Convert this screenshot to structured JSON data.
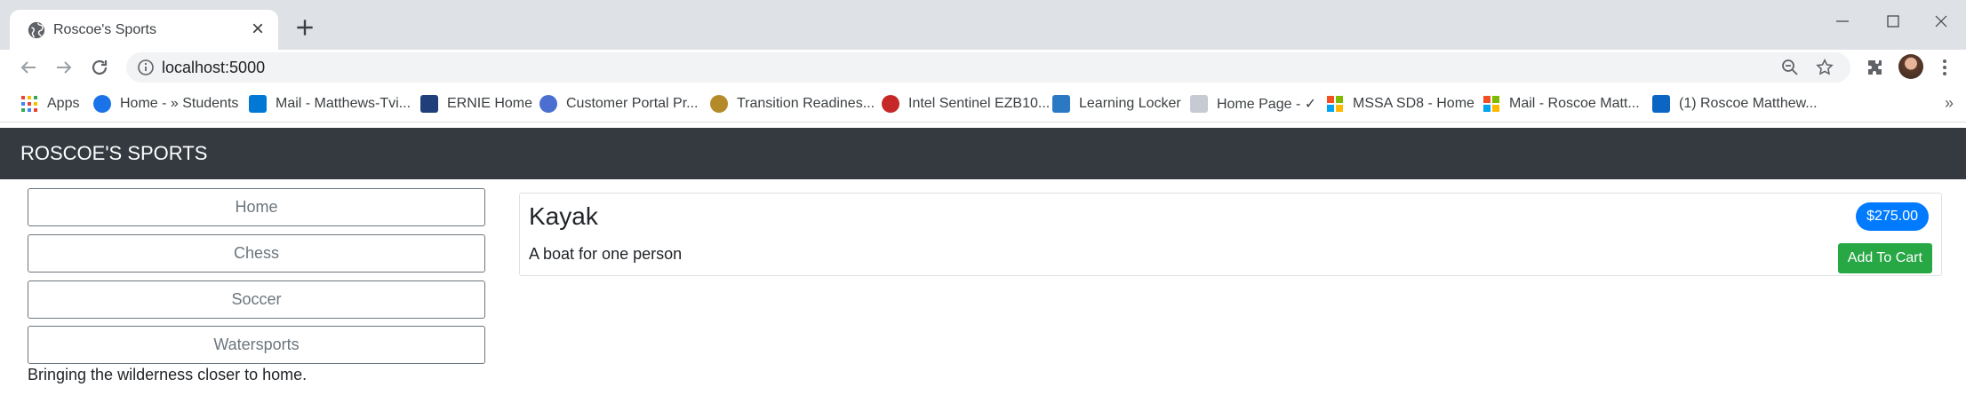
{
  "browser": {
    "tab": {
      "title": "Roscoe's Sports",
      "icon": "globe-icon"
    },
    "address": {
      "url": "localhost:5000"
    },
    "bookmarks": [
      {
        "label": "Apps",
        "icon": "apps-grid-icon",
        "color": "#ea4335"
      },
      {
        "label": "Home - » Students",
        "icon": "students-logo-icon",
        "color": "#1a73e8"
      },
      {
        "label": "Mail - Matthews-Tvi...",
        "icon": "outlook-icon",
        "color": "#0078d4"
      },
      {
        "label": "ERNIE Home",
        "icon": "ernie-logo-icon",
        "color": "#1f3f7a"
      },
      {
        "label": "Customer Portal Pr...",
        "icon": "portal-icon",
        "color": "#4a6fd1"
      },
      {
        "label": "Transition Readines...",
        "icon": "marine-emblem-icon",
        "color": "#b58b2a"
      },
      {
        "label": "Intel Sentinel EZB10...",
        "icon": "sentinel-icon",
        "color": "#c62828"
      },
      {
        "label": "Learning Locker",
        "icon": "learning-locker-icon",
        "color": "#2b79c2"
      },
      {
        "label": "Home Page - ✓",
        "icon": "doc-page-icon",
        "color": "#c5cad3"
      },
      {
        "label": "MSSA SD8 - Home",
        "icon": "microsoft-icon",
        "color": "#f25022"
      },
      {
        "label": "Mail - Roscoe Matt...",
        "icon": "microsoft-icon",
        "color": "#f25022"
      },
      {
        "label": "(1) Roscoe Matthew...",
        "icon": "linkedin-icon",
        "color": "#0a66c2"
      }
    ]
  },
  "site": {
    "brand": "ROSCOE'S SPORTS",
    "categories": [
      "Home",
      "Chess",
      "Soccer",
      "Watersports"
    ],
    "tagline": "Bringing the wilderness closer to home."
  },
  "product": {
    "name": "Kayak",
    "description": "A boat for one person",
    "price": "$275.00",
    "add_label": "Add To Cart"
  },
  "colors": {
    "navbar": "#343a40",
    "price_badge": "#007bff",
    "add_button": "#28a745"
  }
}
